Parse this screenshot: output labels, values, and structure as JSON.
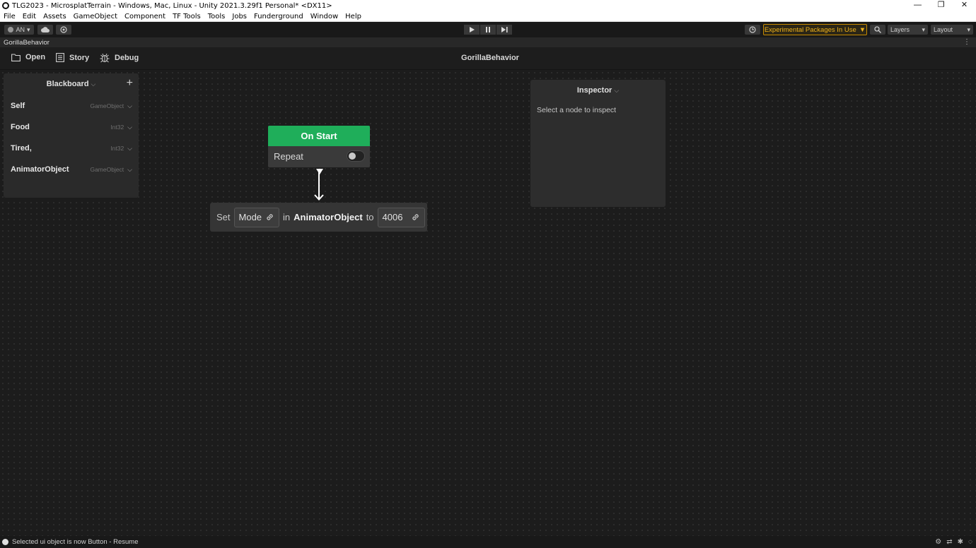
{
  "window": {
    "title": "TLG2023 - MicrosplatTerrain - Windows, Mac, Linux - Unity 2021.3.29f1 Personal* <DX11>",
    "minimize": "—",
    "maximize": "❐",
    "close": "✕"
  },
  "menu": [
    "File",
    "Edit",
    "Assets",
    "GameObject",
    "Component",
    "TF Tools",
    "Tools",
    "Jobs",
    "Funderground",
    "Window",
    "Help"
  ],
  "toolbar": {
    "account_label": "AN",
    "experimental_label": "Experimental Packages In Use",
    "layers_label": "Layers",
    "layout_label": "Layout"
  },
  "tab": {
    "name": "GorillaBehavior"
  },
  "graph_header": {
    "open_label": "Open",
    "story_label": "Story",
    "debug_label": "Debug",
    "title": "GorillaBehavior"
  },
  "blackboard": {
    "title": "Blackboard",
    "add_symbol": "+",
    "variables": [
      {
        "name": "Self",
        "type": "GameObject"
      },
      {
        "name": "Food",
        "type": "Int32"
      },
      {
        "name": "Tired,",
        "type": "Int32"
      },
      {
        "name": "AnimatorObject",
        "type": "GameObject"
      }
    ]
  },
  "inspector": {
    "title": "Inspector",
    "empty_message": "Select a node to inspect"
  },
  "nodes": {
    "on_start": {
      "title": "On Start",
      "repeat_label": "Repeat",
      "repeat_enabled": false
    },
    "set": {
      "word_set": "Set",
      "field": "Mode",
      "word_in": "in",
      "target": "AnimatorObject",
      "word_to": "to",
      "value": "4006"
    }
  },
  "status": {
    "message": "Selected ui object is now Button - Resume"
  },
  "colors": {
    "node_green": "#1fae5a",
    "experimental_accent": "#f0b21a",
    "canvas_bg": "#1c1c1c"
  }
}
